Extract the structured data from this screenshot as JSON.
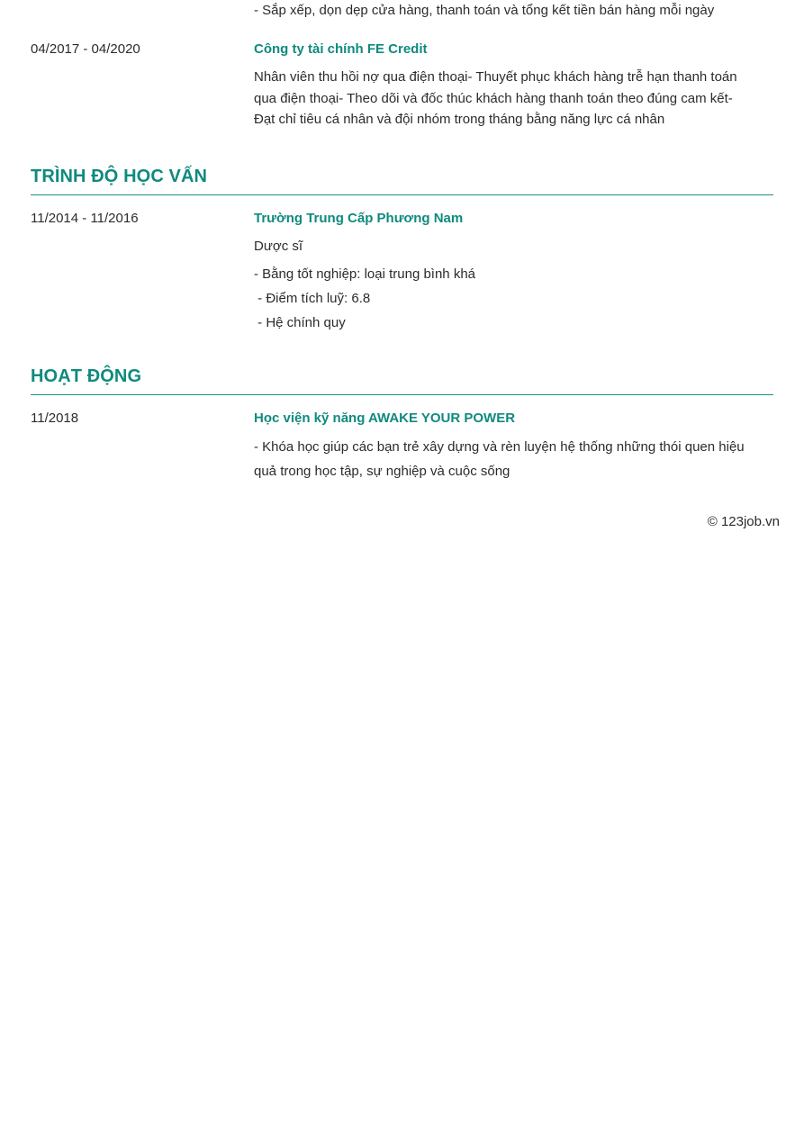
{
  "experience": {
    "prev_tail": "- Sắp xếp, dọn dẹp cửa hàng, thanh toán và tổng kết tiền bán hàng mỗi ngày",
    "job2": {
      "date": "04/2017 - 04/2020",
      "company": "Công ty tài chính FE Credit",
      "desc_lines": [
        "Nhân viên thu hồi nợ qua điện thoại- Thuyết phục khách hàng trễ hạn thanh toán",
        "qua điện thoại- Theo dõi và đốc thúc khách hàng thanh toán theo đúng cam kết-",
        "Đạt chỉ tiêu cá nhân và đội nhóm trong tháng bằng năng lực cá nhân"
      ]
    }
  },
  "education": {
    "title": "TRÌNH ĐỘ HỌC VẤN",
    "entry": {
      "date": "11/2014 - 11/2016",
      "school": "Trường Trung Cấp Phương Nam",
      "major": "Dược sĩ",
      "details": [
        "- Bằng tốt nghiệp: loại trung bình khá",
        " - Điểm tích luỹ: 6.8",
        " - Hệ chính quy"
      ]
    }
  },
  "activities": {
    "title": "HOẠT ĐỘNG",
    "entry": {
      "date": "11/2018",
      "name": "Học viện kỹ năng AWAKE YOUR POWER",
      "desc_lines": [
        "- Khóa học giúp các bạn trẻ xây dựng và rèn luyện hệ thống những thói quen hiệu",
        "quả trong học tập, sự nghiệp và cuộc sống"
      ]
    }
  },
  "footer": {
    "copyright": "© 123job.vn"
  },
  "colors": {
    "accent": "#0f8a7e",
    "text": "#2b2b2b",
    "rule": "#1a8f84"
  }
}
